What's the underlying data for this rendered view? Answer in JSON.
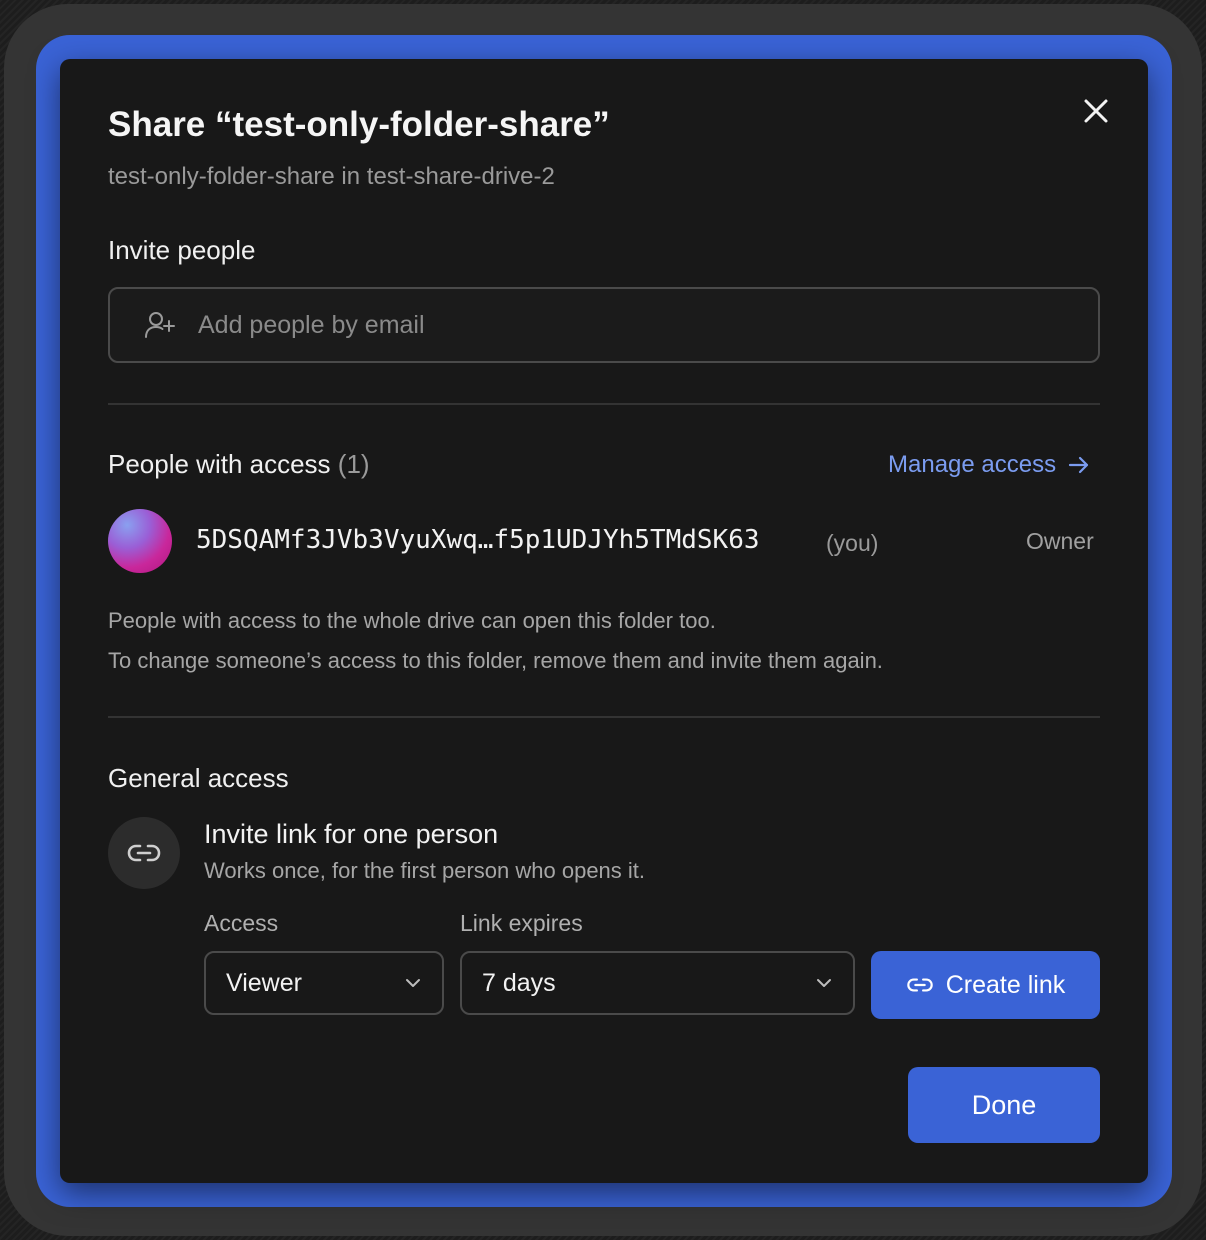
{
  "dialog": {
    "title": "Share “test-only-folder-share”",
    "subtitle": "test-only-folder-share in test-share-drive-2",
    "close_icon": "close-icon"
  },
  "invite": {
    "label": "Invite people",
    "placeholder": "Add people by email",
    "value": "",
    "icon": "add-person-icon"
  },
  "people": {
    "label": "People with access",
    "count": "(1)",
    "manage_label": "Manage access",
    "manage_icon": "arrow-right-icon",
    "members": [
      {
        "id": "5DSQAMf3JVb3VyuXwq…f5p1UDJYh5TMdSK63",
        "you_tag": "(you)",
        "role": "Owner"
      }
    ],
    "note_1": "People with access to the whole drive can open this folder too.",
    "note_2": "To change someone’s access to this folder, remove them and invite them again."
  },
  "general": {
    "label": "General access",
    "link_title": "Invite link for one person",
    "link_desc": "Works once, for the first person who opens it.",
    "link_icon": "link-icon",
    "access_label": "Access",
    "access_value": "Viewer",
    "expires_label": "Link expires",
    "expires_value": "7 days",
    "create_label": "Create link"
  },
  "footer": {
    "done_label": "Done"
  },
  "colors": {
    "accent": "#3a63d6",
    "link": "#7b9cf0",
    "dialog_bg": "#181818"
  }
}
